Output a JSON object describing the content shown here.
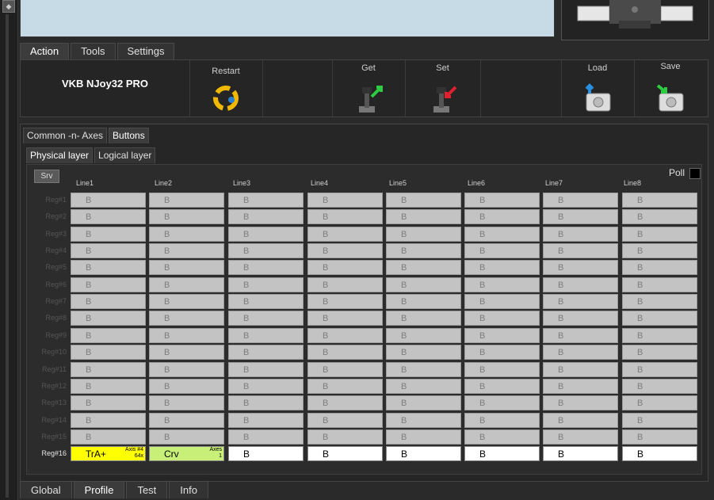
{
  "top_tabs": [
    {
      "label": "Action",
      "active": true
    },
    {
      "label": "Tools",
      "active": false
    },
    {
      "label": "Settings",
      "active": false
    }
  ],
  "toolbar": {
    "device_name": "VKB NJoy32 PRO",
    "restart_label": "Restart",
    "get_label": "Get",
    "set_label": "Set",
    "load_label": "Load",
    "save_label": "Save"
  },
  "section_tabs": [
    {
      "label": "Common -n- Axes",
      "active": false
    },
    {
      "label": "Buttons",
      "active": true
    }
  ],
  "layer_tabs": [
    {
      "label": "Physical layer",
      "active": true
    },
    {
      "label": "Logical layer",
      "active": false
    }
  ],
  "grid": {
    "srv_label": "Srv",
    "poll_label": "Poll",
    "columns": [
      "Line1",
      "Line2",
      "Line3",
      "Line4",
      "Line5",
      "Line6",
      "Line7",
      "Line8"
    ],
    "rows": [
      "Reg#1",
      "Reg#2",
      "Reg#3",
      "Reg#4",
      "Reg#5",
      "Reg#6",
      "Reg#7",
      "Reg#8",
      "Reg#9",
      "Reg#10",
      "Reg#11",
      "Reg#12",
      "Reg#13",
      "Reg#14",
      "Reg#15",
      "Reg#16"
    ],
    "cell_default": "B",
    "last_row": [
      {
        "main": "TrA+",
        "sub1": "Axis #4",
        "sub2": "64x",
        "style": "yellow"
      },
      {
        "main": "Crv",
        "sub1": "Axes",
        "sub2": "1",
        "style": "green"
      },
      {
        "main": "B",
        "style": "active"
      },
      {
        "main": "B",
        "style": "active"
      },
      {
        "main": "B",
        "style": "active"
      },
      {
        "main": "B",
        "style": "active"
      },
      {
        "main": "B",
        "style": "active"
      },
      {
        "main": "B",
        "style": "active"
      }
    ]
  },
  "bottom_tabs": [
    {
      "label": "Global",
      "active": false
    },
    {
      "label": "Profile",
      "active": true
    },
    {
      "label": "Test",
      "active": false
    },
    {
      "label": "Info",
      "active": false
    }
  ],
  "colors": {
    "yellow_cell": "#ffff00",
    "green_cell": "#c8ef78",
    "inactive_cell": "#c3c3c3",
    "active_cell": "#ffffff",
    "top_panel": "#c7dbe7"
  },
  "icons": {
    "restart": "recycle-arrows-icon",
    "get": "joystick-get-icon",
    "set": "joystick-set-icon",
    "load": "disk-load-icon",
    "save": "disk-save-icon"
  }
}
